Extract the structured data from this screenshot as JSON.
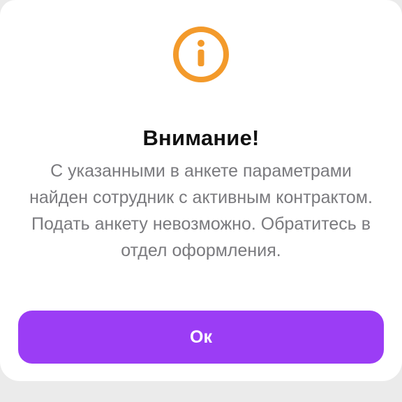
{
  "dialog": {
    "icon": "info-icon",
    "accent_color": "#F39A2B",
    "title": "Внимание!",
    "message": "С указанными в анкете параметрами найден сотрудник с активным контрактом. Подать анкету невозможно. Обратитесь в отдел оформления.",
    "ok_label": "Ок",
    "button_color": "#9B3DF5"
  }
}
